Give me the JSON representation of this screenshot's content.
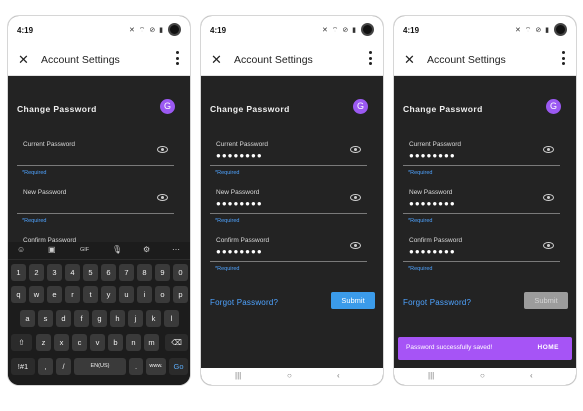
{
  "status_bar": {
    "time": "4:19",
    "icons": "✕ ⌔ ⊘ ▮"
  },
  "app_bar": {
    "title": "Account Settings"
  },
  "section": {
    "heading": "Change Password",
    "avatar_letter": "G"
  },
  "fields": {
    "current_label": "Current Password",
    "new_label": "New Password",
    "confirm_label": "Confirm Password",
    "required_text": "*Required",
    "masked_value": "●●●●●●●●"
  },
  "actions": {
    "forgot_label": "Forgot Password?",
    "submit_label": "Submit"
  },
  "snackbar": {
    "message": "Password successfully saved!",
    "action": "HOME"
  },
  "nav": {
    "recent": "|||",
    "home": "○",
    "back": "‹"
  },
  "keyboard": {
    "tools": [
      "☺",
      "▣",
      "GIF",
      "🎙",
      "⚙",
      "⋯"
    ],
    "row_numbers": [
      "1",
      "2",
      "3",
      "4",
      "5",
      "6",
      "7",
      "8",
      "9",
      "0"
    ],
    "row_q": [
      "q",
      "w",
      "e",
      "r",
      "t",
      "y",
      "u",
      "i",
      "o",
      "p"
    ],
    "row_a": [
      "a",
      "s",
      "d",
      "f",
      "g",
      "h",
      "j",
      "k",
      "l"
    ],
    "row_z": [
      "z",
      "x",
      "c",
      "v",
      "b",
      "n",
      "m"
    ],
    "shift": "⇧",
    "backspace": "⌫",
    "symbols": "!#1",
    "comma": ",",
    "slash": "/",
    "space": "EN(US)",
    "period": ".",
    "www": "www.",
    "go": "Go"
  },
  "colors": {
    "accent_blue": "#3b9bea",
    "link_blue": "#4ea3ff",
    "avatar_purple": "#9b59f2",
    "snackbar_purple": "#a654f6",
    "background_dark": "#232323"
  }
}
